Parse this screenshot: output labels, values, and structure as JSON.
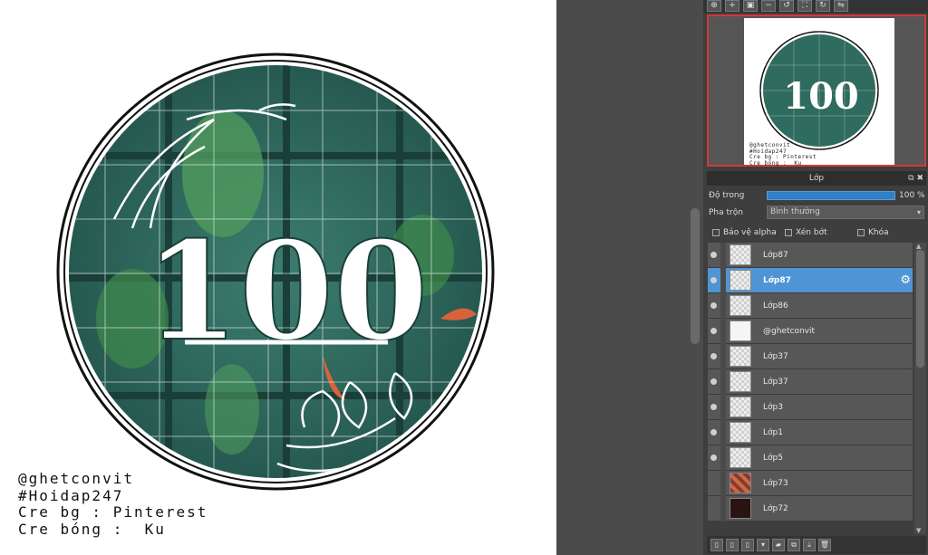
{
  "artwork": {
    "number": "100",
    "credits": [
      "@ghetconvit",
      "#Hoidap247",
      "Cre bg : Pinterest",
      "Cre bóng :  Ku"
    ]
  },
  "toolbar_top": {
    "buttons": [
      "zoom-plus-icon",
      "zoom-in-icon",
      "fit-icon",
      "zoom-out-icon",
      "rotate-left-icon",
      "fit-screen-icon",
      "rotate-right-icon",
      "flip-icon"
    ]
  },
  "layer_panel": {
    "title": "Lớp",
    "opacity_label": "Độ trong",
    "opacity_value": "100 %",
    "opacity_fraction": 1.0,
    "blend_label": "Pha trộn",
    "blend_value": "Bình thường",
    "protect_alpha": "Bảo vệ alpha",
    "clip": "Xén bớt",
    "lock": "Khóa",
    "layers": [
      {
        "name": "Lớp87",
        "thumb": "empty",
        "visible": true,
        "selected": false
      },
      {
        "name": "Lớp87",
        "thumb": "empty",
        "visible": true,
        "selected": true
      },
      {
        "name": "Lớp86",
        "thumb": "empty",
        "visible": true,
        "selected": false
      },
      {
        "name": "@ghetconvit",
        "thumb": "text",
        "visible": true,
        "selected": false
      },
      {
        "name": "Lớp37",
        "thumb": "empty",
        "visible": true,
        "selected": false
      },
      {
        "name": "Lớp37",
        "thumb": "empty",
        "visible": true,
        "selected": false
      },
      {
        "name": "Lớp3",
        "thumb": "empty",
        "visible": true,
        "selected": false
      },
      {
        "name": "Lớp1",
        "thumb": "empty",
        "visible": true,
        "selected": false
      },
      {
        "name": "Lớp5",
        "thumb": "empty",
        "visible": true,
        "selected": false
      },
      {
        "name": "Lớp73",
        "thumb": "tile",
        "visible": false,
        "selected": false
      },
      {
        "name": "Lớp72",
        "thumb": "dark",
        "visible": false,
        "selected": false
      }
    ]
  },
  "colors": {
    "accent": "#4f95d6",
    "navigator_border": "#d03a3a",
    "circle_green": "#2f6b5e"
  }
}
